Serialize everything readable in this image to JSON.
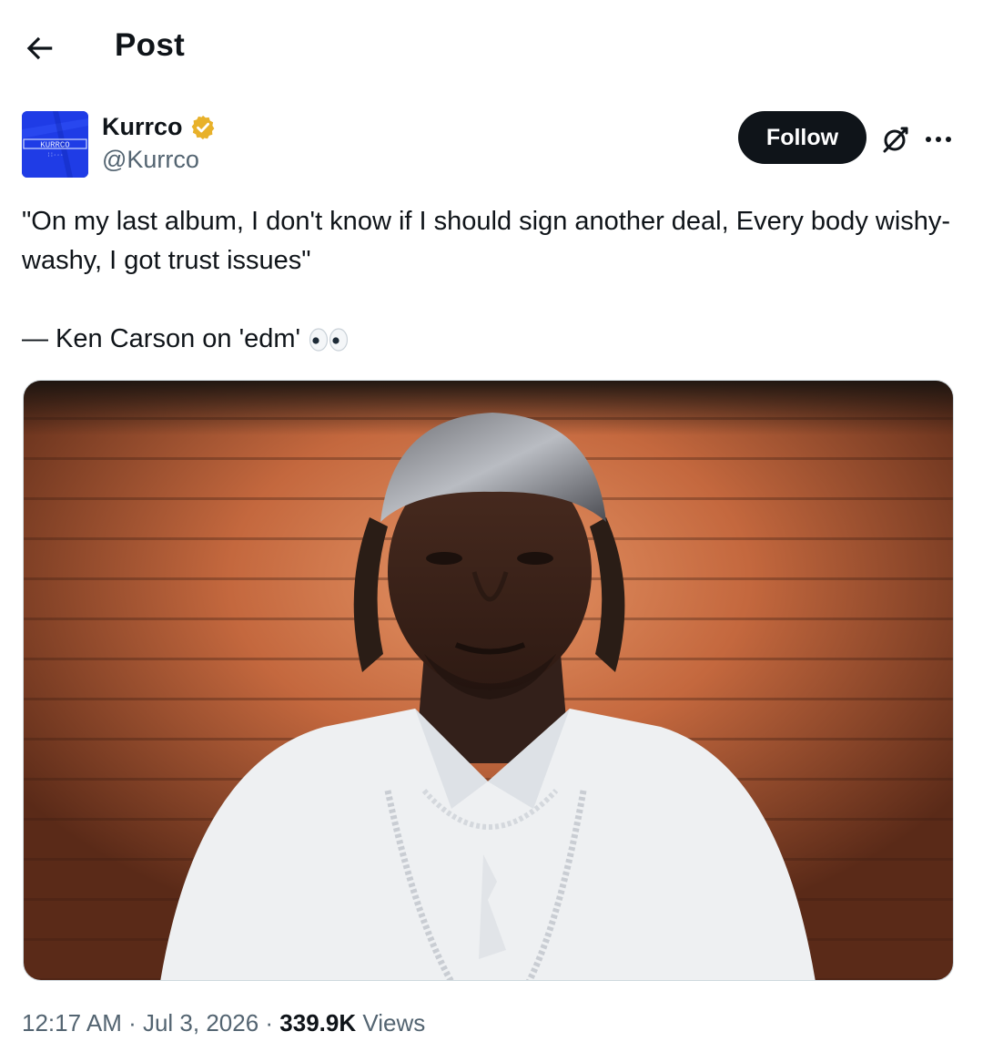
{
  "header": {
    "title": "Post",
    "back_icon": "arrow-left-icon"
  },
  "author": {
    "name": "Kurrco",
    "handle": "@Kurrco",
    "verified": true,
    "verified_color": "#e8b12a",
    "avatar_color": "#1f3ce6",
    "avatar_logo_text": "KURRCO"
  },
  "actions": {
    "follow_label": "Follow",
    "grok_icon": "grok-icon",
    "more_icon": "more-dots-icon"
  },
  "tweet": {
    "line1": "\"On my last album, I don't know if I should sign another deal, Every body wishy-washy, I got trust issues\"",
    "line2": "— Ken Carson on 'edm'",
    "emoji": "👀"
  },
  "media": {
    "type": "photo",
    "icon": "photo-portrait"
  },
  "meta": {
    "time": "12:17 AM",
    "sep1": " · ",
    "date": "Jul 3, 2026",
    "sep2": " · ",
    "views_count": "339.9K",
    "views_label": " Views"
  },
  "colors": {
    "text": "#0f1419",
    "secondary": "#536471",
    "follow_bg": "#0f1419"
  }
}
